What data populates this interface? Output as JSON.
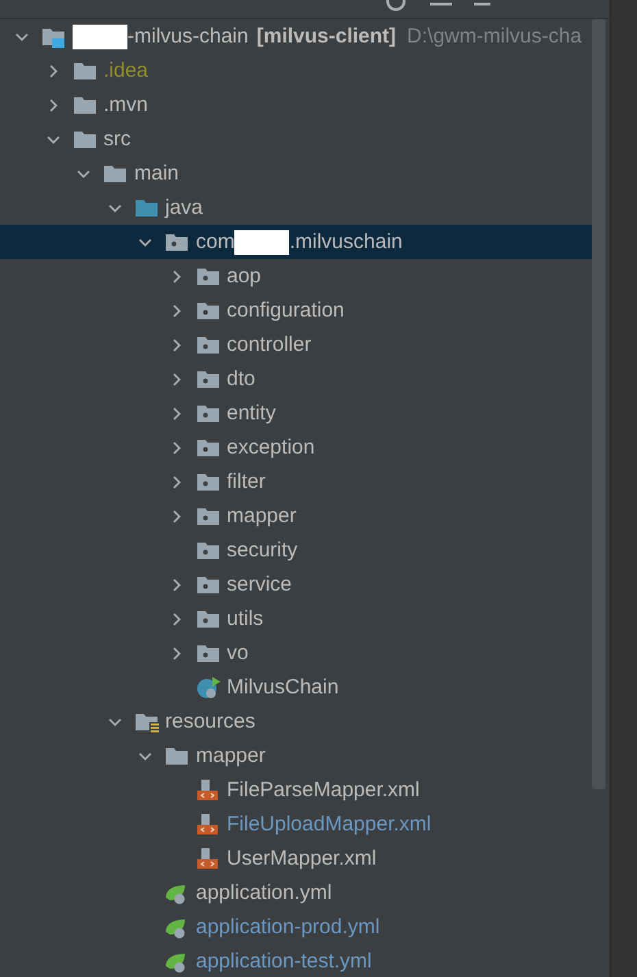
{
  "tree": [
    {
      "kind": "module",
      "label_after": "-milvus-chain",
      "redacted": true,
      "module": "[milvus-client]",
      "path": "D:\\gwm-milvus-cha",
      "color": "#bbbbbb",
      "expanded": true,
      "selected": false,
      "children": [
        {
          "kind": "folder",
          "label": ".idea",
          "color": "#8f8f2e",
          "expanded": false,
          "selected": false
        },
        {
          "kind": "folder",
          "label": ".mvn",
          "color": "#bbbbbb",
          "expanded": false,
          "selected": false
        },
        {
          "kind": "folder",
          "label": "src",
          "color": "#bbbbbb",
          "expanded": true,
          "selected": false,
          "children": [
            {
              "kind": "folder",
              "label": "main",
              "color": "#bbbbbb",
              "expanded": true,
              "selected": false,
              "children": [
                {
                  "kind": "source",
                  "label": "java",
                  "color": "#bbbbbb",
                  "expanded": true,
                  "selected": false,
                  "children": [
                    {
                      "kind": "package",
                      "label": "com",
                      "redacted": true,
                      "label_after": ".milvuschain",
                      "color": "#bbbbbb",
                      "expanded": true,
                      "selected": true,
                      "children": [
                        {
                          "kind": "package",
                          "label": "aop",
                          "color": "#bbbbbb",
                          "expanded": false,
                          "selected": false
                        },
                        {
                          "kind": "package",
                          "label": "configuration",
                          "color": "#bbbbbb",
                          "expanded": false,
                          "selected": false
                        },
                        {
                          "kind": "package",
                          "label": "controller",
                          "color": "#bbbbbb",
                          "expanded": false,
                          "selected": false
                        },
                        {
                          "kind": "package",
                          "label": "dto",
                          "color": "#bbbbbb",
                          "expanded": false,
                          "selected": false
                        },
                        {
                          "kind": "package",
                          "label": "entity",
                          "color": "#bbbbbb",
                          "expanded": false,
                          "selected": false
                        },
                        {
                          "kind": "package",
                          "label": "exception",
                          "color": "#bbbbbb",
                          "expanded": false,
                          "selected": false
                        },
                        {
                          "kind": "package",
                          "label": "filter",
                          "color": "#bbbbbb",
                          "expanded": false,
                          "selected": false
                        },
                        {
                          "kind": "package",
                          "label": "mapper",
                          "color": "#bbbbbb",
                          "expanded": false,
                          "selected": false
                        },
                        {
                          "kind": "package",
                          "label": "security",
                          "color": "#bbbbbb",
                          "selected": false
                        },
                        {
                          "kind": "package",
                          "label": "service",
                          "color": "#bbbbbb",
                          "expanded": false,
                          "selected": false
                        },
                        {
                          "kind": "package",
                          "label": "utils",
                          "color": "#bbbbbb",
                          "expanded": false,
                          "selected": false
                        },
                        {
                          "kind": "package",
                          "label": "vo",
                          "color": "#bbbbbb",
                          "expanded": false,
                          "selected": false
                        },
                        {
                          "kind": "class",
                          "label": "MilvusChain",
                          "color": "#bbbbbb",
                          "selected": false
                        }
                      ]
                    }
                  ]
                },
                {
                  "kind": "resources",
                  "label": "resources",
                  "color": "#bbbbbb",
                  "expanded": true,
                  "selected": false,
                  "children": [
                    {
                      "kind": "folder",
                      "label": "mapper",
                      "color": "#bbbbbb",
                      "expanded": true,
                      "selected": false,
                      "children": [
                        {
                          "kind": "xml",
                          "label": "FileParseMapper.xml",
                          "color": "#bbbbbb",
                          "selected": false
                        },
                        {
                          "kind": "xml",
                          "label": "FileUploadMapper.xml",
                          "color": "#6b97c3",
                          "selected": false
                        },
                        {
                          "kind": "xml",
                          "label": "UserMapper.xml",
                          "color": "#bbbbbb",
                          "selected": false
                        }
                      ]
                    },
                    {
                      "kind": "yml",
                      "label": "application.yml",
                      "color": "#bbbbbb",
                      "selected": false
                    },
                    {
                      "kind": "yml",
                      "label": "application-prod.yml",
                      "color": "#6b97c3",
                      "selected": false
                    },
                    {
                      "kind": "yml",
                      "label": "application-test.yml",
                      "color": "#6b97c3",
                      "selected": false
                    }
                  ]
                }
              ]
            }
          ]
        }
      ]
    }
  ]
}
